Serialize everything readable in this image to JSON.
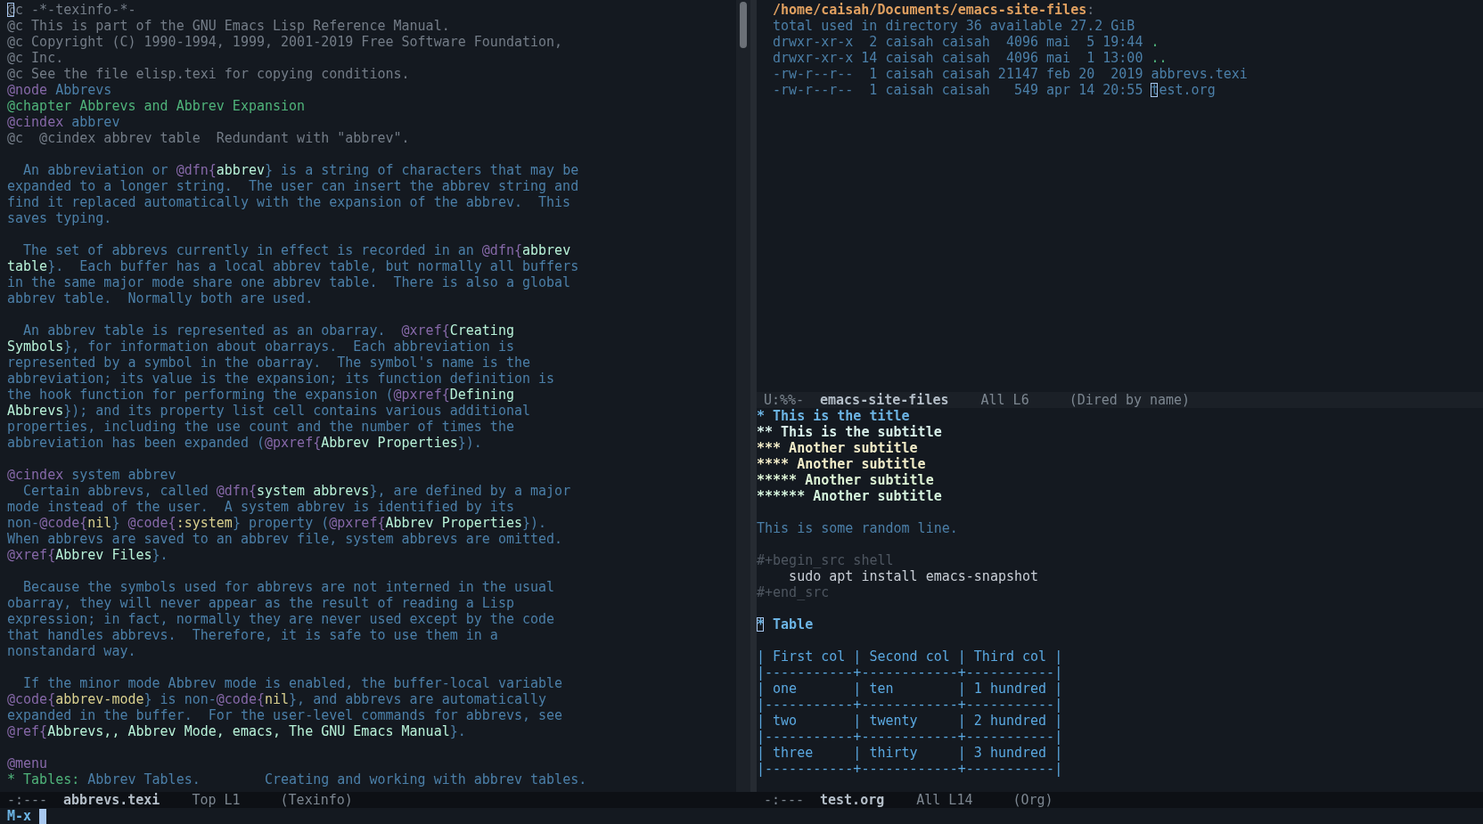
{
  "left_window": {
    "lines": [
      {
        "cursor": true,
        "segments": [
          {
            "kind": "comment",
            "text": "@c -*-texinfo-*-"
          }
        ]
      },
      {
        "segments": [
          {
            "kind": "comment",
            "text": "@c This is part of the GNU Emacs Lisp Reference Manual."
          }
        ]
      },
      {
        "segments": [
          {
            "kind": "comment",
            "text": "@c Copyright (C) 1990-1994, 1999, 2001-2019 Free Software Foundation,"
          }
        ]
      },
      {
        "segments": [
          {
            "kind": "comment",
            "text": "@c Inc."
          }
        ]
      },
      {
        "segments": [
          {
            "kind": "comment",
            "text": "@c See the file elisp.texi for copying conditions."
          }
        ]
      },
      {
        "segments": [
          {
            "kind": "keyword",
            "text": "@node"
          },
          {
            "kind": "text",
            "text": " Abbrevs"
          }
        ]
      },
      {
        "segments": [
          {
            "kind": "heading",
            "text": "@chapter Abbrevs and Abbrev Expansion"
          }
        ]
      },
      {
        "segments": [
          {
            "kind": "keyword",
            "text": "@cindex"
          },
          {
            "kind": "text",
            "text": " abbrev"
          }
        ]
      },
      {
        "segments": [
          {
            "kind": "comment",
            "text": "@c  @cindex abbrev table  Redundant with \"abbrev\"."
          }
        ]
      },
      {
        "kind": "blank"
      },
      {
        "segments": [
          {
            "kind": "text",
            "text": "  An abbreviation or "
          },
          {
            "kind": "keyword",
            "text": "@dfn{"
          },
          {
            "kind": "arg",
            "text": "abbrev"
          },
          {
            "kind": "text",
            "text": "} is a string of characters that may be"
          }
        ]
      },
      {
        "segments": [
          {
            "kind": "text",
            "text": "expanded to a longer string.  The user can insert the abbrev string and"
          }
        ]
      },
      {
        "segments": [
          {
            "kind": "text",
            "text": "find it replaced automatically with the expansion of the abbrev.  This"
          }
        ]
      },
      {
        "segments": [
          {
            "kind": "text",
            "text": "saves typing."
          }
        ]
      },
      {
        "kind": "blank"
      },
      {
        "segments": [
          {
            "kind": "text",
            "text": "  The set of abbrevs currently in effect is recorded in an "
          },
          {
            "kind": "keyword",
            "text": "@dfn{"
          },
          {
            "kind": "arg",
            "text": "abbrev"
          }
        ]
      },
      {
        "segments": [
          {
            "kind": "arg",
            "text": "table"
          },
          {
            "kind": "text",
            "text": "}.  Each buffer has a local abbrev table, but normally all buffers"
          }
        ]
      },
      {
        "segments": [
          {
            "kind": "text",
            "text": "in the same major mode share one abbrev table.  There is also a global"
          }
        ]
      },
      {
        "segments": [
          {
            "kind": "text",
            "text": "abbrev table.  Normally both are used."
          }
        ]
      },
      {
        "kind": "blank"
      },
      {
        "segments": [
          {
            "kind": "text",
            "text": "  An abbrev table is represented as an obarray.  "
          },
          {
            "kind": "keyword",
            "text": "@xref{"
          },
          {
            "kind": "arg",
            "text": "Creating"
          }
        ]
      },
      {
        "segments": [
          {
            "kind": "arg",
            "text": "Symbols"
          },
          {
            "kind": "text",
            "text": "}, for information about obarrays.  Each abbreviation is"
          }
        ]
      },
      {
        "segments": [
          {
            "kind": "text",
            "text": "represented by a symbol in the obarray.  The symbol's name is the"
          }
        ]
      },
      {
        "segments": [
          {
            "kind": "text",
            "text": "abbreviation; its value is the expansion; its function definition is"
          }
        ]
      },
      {
        "segments": [
          {
            "kind": "text",
            "text": "the hook function for performing the expansion ("
          },
          {
            "kind": "keyword",
            "text": "@pxref{"
          },
          {
            "kind": "arg",
            "text": "Defining"
          }
        ]
      },
      {
        "segments": [
          {
            "kind": "arg",
            "text": "Abbrevs"
          },
          {
            "kind": "text",
            "text": "}); and its property list cell contains various additional"
          }
        ]
      },
      {
        "segments": [
          {
            "kind": "text",
            "text": "properties, including the use count and the number of times the"
          }
        ]
      },
      {
        "segments": [
          {
            "kind": "text",
            "text": "abbreviation has been expanded ("
          },
          {
            "kind": "keyword",
            "text": "@pxref{"
          },
          {
            "kind": "arg",
            "text": "Abbrev Properties"
          },
          {
            "kind": "text",
            "text": "})."
          }
        ]
      },
      {
        "kind": "blank"
      },
      {
        "segments": [
          {
            "kind": "keyword",
            "text": "@cindex"
          },
          {
            "kind": "text",
            "text": " system abbrev"
          }
        ]
      },
      {
        "segments": [
          {
            "kind": "text",
            "text": "  Certain abbrevs, called "
          },
          {
            "kind": "keyword",
            "text": "@dfn{"
          },
          {
            "kind": "arg",
            "text": "system abbrevs"
          },
          {
            "kind": "text",
            "text": "}, are defined by a major"
          }
        ]
      },
      {
        "segments": [
          {
            "kind": "text",
            "text": "mode instead of the user.  A system abbrev is identified by its"
          }
        ]
      },
      {
        "segments": [
          {
            "kind": "text",
            "text": "non-"
          },
          {
            "kind": "keyword",
            "text": "@code{"
          },
          {
            "kind": "code",
            "text": "nil"
          },
          {
            "kind": "text",
            "text": "} "
          },
          {
            "kind": "keyword",
            "text": "@code{"
          },
          {
            "kind": "code",
            "text": ":system"
          },
          {
            "kind": "text",
            "text": "} property ("
          },
          {
            "kind": "keyword",
            "text": "@pxref{"
          },
          {
            "kind": "arg",
            "text": "Abbrev Properties"
          },
          {
            "kind": "text",
            "text": "})."
          }
        ]
      },
      {
        "segments": [
          {
            "kind": "text",
            "text": "When abbrevs are saved to an abbrev file, system abbrevs are omitted."
          }
        ]
      },
      {
        "segments": [
          {
            "kind": "keyword",
            "text": "@xref{"
          },
          {
            "kind": "arg",
            "text": "Abbrev Files"
          },
          {
            "kind": "text",
            "text": "}."
          }
        ]
      },
      {
        "kind": "blank"
      },
      {
        "segments": [
          {
            "kind": "text",
            "text": "  Because the symbols used for abbrevs are not interned in the usual"
          }
        ]
      },
      {
        "segments": [
          {
            "kind": "text",
            "text": "obarray, they will never appear as the result of reading a Lisp"
          }
        ]
      },
      {
        "segments": [
          {
            "kind": "text",
            "text": "expression; in fact, normally they are never used except by the code"
          }
        ]
      },
      {
        "segments": [
          {
            "kind": "text",
            "text": "that handles abbrevs.  Therefore, it is safe to use them in a"
          }
        ]
      },
      {
        "segments": [
          {
            "kind": "text",
            "text": "nonstandard way."
          }
        ]
      },
      {
        "kind": "blank"
      },
      {
        "segments": [
          {
            "kind": "text",
            "text": "  If the minor mode Abbrev mode is enabled, the buffer-local variable"
          }
        ]
      },
      {
        "segments": [
          {
            "kind": "keyword",
            "text": "@code{"
          },
          {
            "kind": "code",
            "text": "abbrev-mode"
          },
          {
            "kind": "text",
            "text": "} is non-"
          },
          {
            "kind": "keyword",
            "text": "@code{"
          },
          {
            "kind": "code",
            "text": "nil"
          },
          {
            "kind": "text",
            "text": "}, and abbrevs are automatically"
          }
        ]
      },
      {
        "segments": [
          {
            "kind": "text",
            "text": "expanded in the buffer.  For the user-level commands for abbrevs, see"
          }
        ]
      },
      {
        "segments": [
          {
            "kind": "keyword",
            "text": "@ref{"
          },
          {
            "kind": "arg",
            "text": "Abbrevs,, Abbrev Mode, emacs, The GNU Emacs Manual"
          },
          {
            "kind": "text",
            "text": "}."
          }
        ]
      },
      {
        "kind": "blank"
      },
      {
        "segments": [
          {
            "kind": "keyword",
            "text": "@menu"
          }
        ]
      },
      {
        "segments": [
          {
            "kind": "heading",
            "text": "* Tables:"
          },
          {
            "kind": "text",
            "text": " Abbrev Tables.        Creating and working with abbrev tables."
          }
        ]
      }
    ],
    "mode_line": {
      "state": "-:---",
      "buffer": "abbrevs.texi",
      "position": "Top L1",
      "mode": "(Texinfo)"
    }
  },
  "dired_window": {
    "header": "/home/caisah/Documents/emacs-site-files",
    "header_suffix": ":",
    "total": "total used in directory 36 available 27.2 GiB",
    "entries": [
      {
        "info": "drwxr-xr-x  2 caisah caisah  4096 mai  5 19:44 ",
        "name": ".",
        "kind": "dir",
        "cursor": false
      },
      {
        "info": "drwxr-xr-x 14 caisah caisah  4096 mai  1 13:00 ",
        "name": "..",
        "kind": "dir",
        "cursor": false
      },
      {
        "info": "-rw-r--r--  1 caisah caisah 21147 feb 20  2019 ",
        "name": "abbrevs.texi",
        "kind": "file",
        "cursor": false
      },
      {
        "info": "-rw-r--r--  1 caisah caisah   549 apr 14 20:55 ",
        "name": "test.org",
        "kind": "file",
        "cursor": true
      }
    ],
    "mode_line": {
      "state": "U:%%-",
      "buffer": "emacs-site-files",
      "position": "All L6",
      "mode": "(Dired by name)"
    }
  },
  "org_window": {
    "items": [
      {
        "kind": "heading",
        "text": "* This is the title",
        "cursor": false,
        "children": [
          {
            "kind": "heading",
            "text": "** This is the subtitle",
            "cursor": false,
            "children": [
              {
                "kind": "heading",
                "text": "*** Another subtitle",
                "cursor": false,
                "children": [
                  {
                    "kind": "heading",
                    "text": "**** Another subtitle",
                    "cursor": false,
                    "children": [
                      {
                        "kind": "heading",
                        "text": "***** Another subtitle",
                        "cursor": false,
                        "children": [
                          {
                            "kind": "heading",
                            "text": "****** Another subtitle",
                            "cursor": false
                          }
                        ]
                      }
                    ]
                  }
                ]
              }
            ]
          }
        ]
      },
      {
        "kind": "blank"
      },
      {
        "kind": "text",
        "text": "This is some random line."
      },
      {
        "kind": "blank"
      },
      {
        "kind": "meta",
        "text": "#+begin_src shell"
      },
      {
        "kind": "code",
        "text": "    sudo apt install emacs-snapshot"
      },
      {
        "kind": "meta",
        "text": "#+end_src"
      },
      {
        "kind": "blank"
      },
      {
        "kind": "heading",
        "text": "* Table",
        "cursor": true
      },
      {
        "kind": "blank"
      },
      {
        "kind": "table",
        "text": "| First col | Second col | Third col |"
      },
      {
        "kind": "table",
        "text": "|-----------+------------+-----------|"
      },
      {
        "kind": "table",
        "text": "| one       | ten        | 1 hundred |"
      },
      {
        "kind": "table",
        "text": "|-----------+------------+-----------|"
      },
      {
        "kind": "table",
        "text": "| two       | twenty     | 2 hundred |"
      },
      {
        "kind": "table",
        "text": "|-----------+------------+-----------|"
      },
      {
        "kind": "table",
        "text": "| three     | thirty     | 3 hundred |"
      },
      {
        "kind": "table",
        "text": "|-----------+------------+-----------|"
      }
    ],
    "mode_line": {
      "state": "-:---",
      "buffer": "test.org",
      "position": "All L14",
      "mode": "(Org)"
    }
  },
  "minibuffer": {
    "prompt": "M-x"
  }
}
